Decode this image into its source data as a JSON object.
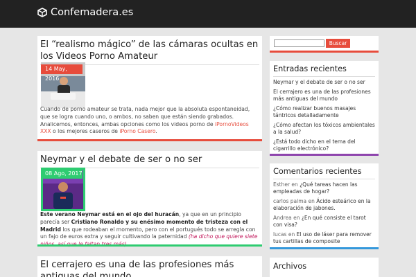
{
  "site": {
    "title": "Confemadera.es"
  },
  "posts": [
    {
      "title": "El “realismo mágico” de las cámaras ocultas en los Videos Porno Amateur",
      "date": "14 May, 2016",
      "excerpt_parts": [
        "Cuando de porno amateur se trata, nada mejor que la absoluta espontaneidad, que se logra cuando uno, o ambos, no saben que están siendo grabados. Analicemos, entonces, ambas opciones como los videos porno de ",
        "iPornoVideos XXX",
        " o los mejores caseros de ",
        "iPorno Casero",
        "."
      ]
    },
    {
      "title": "Neymar y el debate de ser o no ser",
      "date": "08 Ago, 2017",
      "excerpt_parts": [
        "Este verano Neymar está en el ojo del huracán",
        ", ya que en un principio parecía ser ",
        "Cristiano Ronaldo y su enésimo momento de tristeza con el Madrid",
        " los que rodeaban el momento, pero con el portugués todo se arregla con un fajo de euros extra y seguir cultivando la paternidad ",
        "(ha dicho que quiere siete niños, así que le faltan tres más)",
        "."
      ]
    },
    {
      "title": "El cerrajero es una de las profesiones más antiguas del mundo"
    }
  ],
  "search": {
    "button_label": "Buscar",
    "placeholder": ""
  },
  "recent_posts": {
    "title": "Entradas recientes",
    "items": [
      "Neymar y el debate de ser o no ser",
      "El cerrajero es una de las profesiones más antiguas del mundo",
      "¿Cómo realizar buenos masajes tántricos detalladamente",
      "¿Cómo afectan los tóxicos ambientales a la salud?",
      "¿Está todo dicho en el tema del cigarrillo electrónico?"
    ]
  },
  "recent_comments": {
    "title": "Comentarios recientes",
    "items": [
      {
        "author": "Esther",
        "sep": " en ",
        "post": "¿Qué tareas hacen las empleadas de hogar?"
      },
      {
        "author": "carlos palma",
        "sep": " en ",
        "post": "Ácido esteárico en la elaboración de jabones."
      },
      {
        "author": "Andrea",
        "sep": " en ",
        "post": "¿En qué consiste el tarot con visa?"
      },
      {
        "author": "lucas",
        "sep": " en ",
        "post": "El uso de láser para remover tus cartillas de composite"
      }
    ]
  },
  "archives": {
    "title": "Archivos"
  },
  "colors": {
    "accent": "#e74c3c",
    "post1_bar": "#e74c3c",
    "post2_bar": "#2ecc71",
    "post2_badge": "#2ecc71",
    "widget1_bar": "#e74c3c",
    "widget2_bar": "#8e44ad",
    "widget3_bar": "#3498db"
  }
}
